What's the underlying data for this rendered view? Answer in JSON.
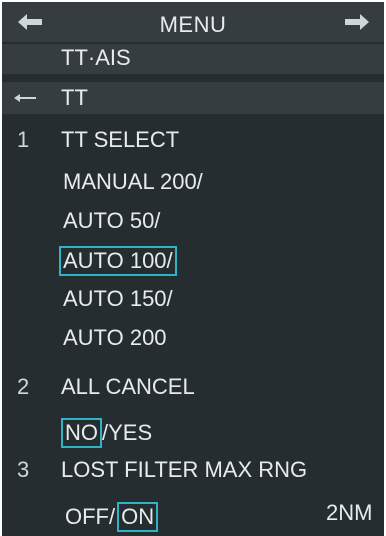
{
  "header": {
    "title": "MENU",
    "back_icon": "left-arrow-icon",
    "forward_icon": "right-arrow-icon"
  },
  "breadcrumb": {
    "level1": "TT·AIS",
    "back_icon": "small-left-arrow-icon",
    "level2": "TT"
  },
  "items": {
    "tt_select": {
      "number": "1",
      "label": "TT SELECT",
      "options": [
        "MANUAL 200/",
        "AUTO 50/",
        "AUTO 100/",
        "AUTO 150/",
        "AUTO 200"
      ],
      "selected_index": 2
    },
    "all_cancel": {
      "number": "2",
      "label": "ALL CANCEL",
      "opt_no": "NO",
      "separator": "/",
      "opt_yes": "YES",
      "selected": "NO"
    },
    "lost_filter": {
      "number": "3",
      "label": "LOST FILTER MAX RNG",
      "opt_off": "OFF",
      "separator": "/",
      "opt_on": "ON",
      "selected": "ON",
      "range_value": "2NM"
    }
  },
  "colors": {
    "panel_bg": "#262d31",
    "bar_bg": "#363d41",
    "text": "#e6ebee",
    "highlight_border": "#2fb4c6"
  }
}
